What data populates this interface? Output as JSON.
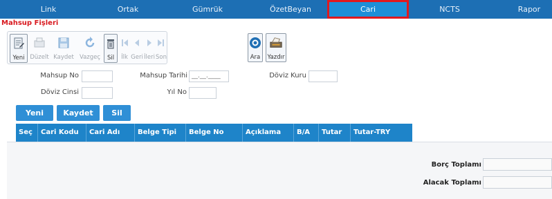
{
  "nav": {
    "items": [
      {
        "label": "Link"
      },
      {
        "label": "Ortak"
      },
      {
        "label": "Gümrük"
      },
      {
        "label": "ÖzetBeyan"
      },
      {
        "label": "Cari",
        "active": true
      },
      {
        "label": "NCTS"
      },
      {
        "label": "Rapor"
      }
    ]
  },
  "page": {
    "title": "Mahsup Fişleri"
  },
  "toolbar": {
    "new_label": "Yeni",
    "edit_label": "Düzelt",
    "save_label": "Kaydet",
    "cancel_label": "Vazgeç",
    "delete_label": "Sil",
    "first_label": "İlk",
    "prev_label": "Geri",
    "next_label": "İleri",
    "last_label": "Son",
    "search_label": "Ara",
    "print_label": "Yazdır"
  },
  "form": {
    "mahsup_no_label": "Mahsup No",
    "mahsup_no_value": "",
    "mahsup_tarihi_label": "Mahsup Tarihi",
    "mahsup_tarihi_value": "__.__.____",
    "doviz_kuru_label": "Döviz Kuru",
    "doviz_kuru_value": "",
    "doviz_cinsi_label": "Döviz Cinsi",
    "doviz_cinsi_value": "",
    "yil_no_label": "Yıl No",
    "yil_no_value": ""
  },
  "actions": {
    "new_label": "Yeni",
    "save_label": "Kaydet",
    "delete_label": "Sil"
  },
  "grid": {
    "columns": [
      "Seç",
      "Cari Kodu",
      "Cari Adı",
      "Belge Tipi",
      "Belge No",
      "Açıklama",
      "B/A",
      "Tutar",
      "Tutar-TRY"
    ]
  },
  "totals": {
    "borc_label": "Borç Toplamı",
    "alacak_label": "Alacak Toplamı"
  },
  "colors": {
    "nav_bg": "#1d6fb4",
    "accent": "#2f8fd6",
    "active_border": "#e0191f",
    "title_red": "#d8191f"
  }
}
